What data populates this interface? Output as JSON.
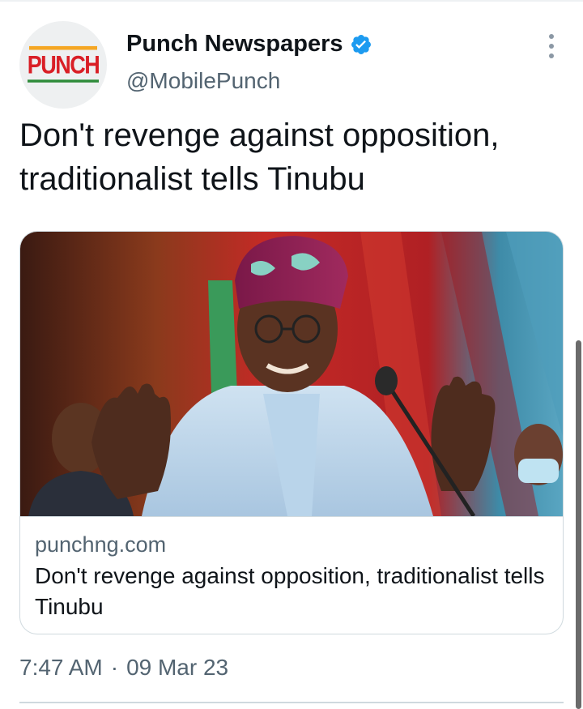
{
  "author": {
    "logo_text": "PUNCH",
    "display_name": "Punch Newspapers",
    "handle": "@MobilePunch",
    "verified": true
  },
  "tweet": {
    "text": "Don't revenge against opposition, traditionalist tells Tinubu",
    "time": "7:47 AM",
    "separator": "·",
    "date": "09 Mar 23"
  },
  "card": {
    "domain": "punchng.com",
    "title": "Don't revenge against opposition, traditionalist tells Tinubu"
  },
  "colors": {
    "verified": "#1d9bf0",
    "secondary_text": "#536471",
    "brand_red": "#d91f26"
  },
  "icons": {
    "verified": "verified-badge-icon",
    "more": "more-options-icon"
  }
}
